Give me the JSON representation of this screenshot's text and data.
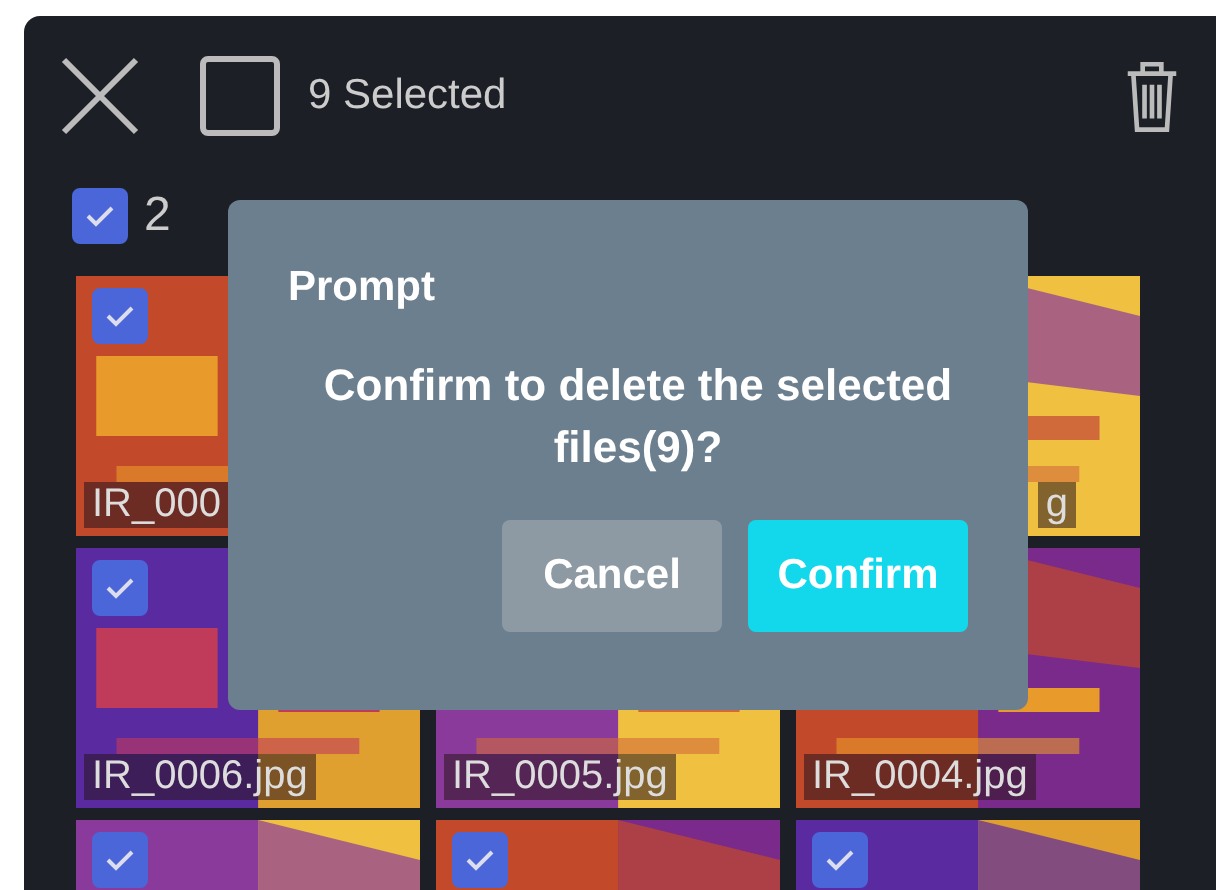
{
  "header": {
    "select_all_checked": false,
    "selected_count": "9 Selected"
  },
  "group": {
    "checked": true,
    "label": "2"
  },
  "rows": [
    [
      {
        "label": "IR_000",
        "checked": true
      },
      {},
      {
        "label": "g",
        "cut_start": true
      }
    ],
    [
      {
        "label": "IR_0006.jpg",
        "checked": true
      },
      {
        "label": "IR_0005.jpg"
      },
      {
        "label": "IR_0004.jpg"
      }
    ],
    [
      {
        "checked": true
      },
      {
        "checked": true
      },
      {
        "checked": true
      }
    ]
  ],
  "dialog": {
    "title": "Prompt",
    "message": "Confirm to delete the selected files(9)?",
    "buttons": [
      {
        "label": "Cancel",
        "kind": "secondary"
      },
      {
        "label": "Confirm",
        "kind": "primary"
      }
    ]
  }
}
